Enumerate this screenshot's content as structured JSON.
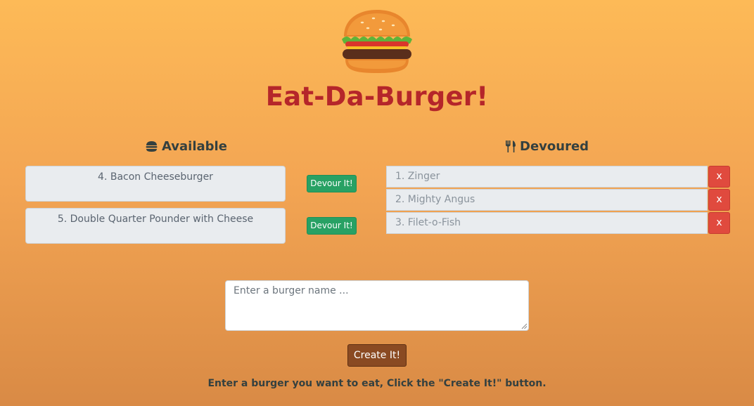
{
  "app": {
    "title": "Eat-Da-Burger!",
    "logo_icon": "burger-emoji"
  },
  "columns": {
    "available": {
      "label": "Available",
      "icon": "burger-icon"
    },
    "devoured": {
      "label": "Devoured",
      "icon": "utensils-icon"
    }
  },
  "available_items": [
    {
      "label": "4. Bacon Cheeseburger",
      "button": "Devour It!"
    },
    {
      "label": "5. Double Quarter Pounder with Cheese",
      "button": "Devour It!"
    }
  ],
  "devoured_items": [
    {
      "label": "1. Zinger",
      "delete": "x"
    },
    {
      "label": "2. Mighty Angus",
      "delete": "x"
    },
    {
      "label": "3. Filet-o-Fish",
      "delete": "x"
    }
  ],
  "form": {
    "placeholder": "Enter a burger name ...",
    "value": "",
    "submit_label": "Create It!",
    "hint": "Enter a burger you want to eat, Click the \"Create It!\" button."
  },
  "colors": {
    "title": "#b5262a",
    "devour_button": "#28a164",
    "delete_button": "#e04a3e",
    "create_button": "#8a4a22"
  }
}
